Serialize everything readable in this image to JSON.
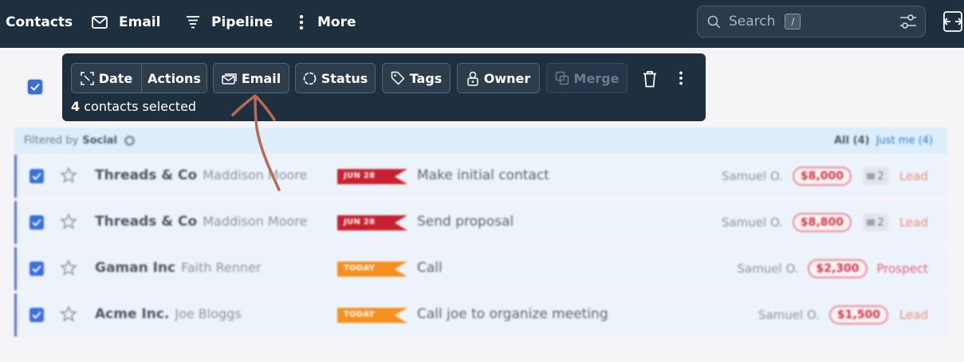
{
  "nav": {
    "contacts": "Contacts",
    "email": "Email",
    "pipeline": "Pipeline",
    "more": "More",
    "search_placeholder": "Search",
    "search_shortcut": "/"
  },
  "toolbar": {
    "date": "Date",
    "actions": "Actions",
    "email": "Email",
    "status": "Status",
    "tags": "Tags",
    "owner": "Owner",
    "merge": "Merge",
    "selected_count": "4",
    "selected_suffix": "contacts selected"
  },
  "filter": {
    "label": "Filtered by",
    "value": "Social",
    "all": "All (4)",
    "just_me": "Just me (4)"
  },
  "rows": [
    {
      "company": "Threads & Co",
      "person": "Maddison Moore",
      "due": "JUN 28",
      "task": "Make initial contact",
      "owner": "Samuel O.",
      "value": "$8,000",
      "files": "2",
      "stage": "Lead"
    },
    {
      "company": "Threads & Co",
      "person": "Maddison Moore",
      "due": "JUN 28",
      "task": "Send proposal",
      "owner": "Samuel O.",
      "value": "$8,800",
      "files": "2",
      "stage": "Lead"
    },
    {
      "company": "Gaman Inc",
      "person": "Faith Renner",
      "due": "TODAY",
      "task": "Call",
      "owner": "Samuel O.",
      "value": "$2,300",
      "files": "",
      "stage": "Prospect"
    },
    {
      "company": "Acme Inc.",
      "person": "Joe Bloggs",
      "due": "TODAY",
      "task": "Call joe to organize meeting",
      "owner": "Samuel O.",
      "value": "$1,500",
      "files": "",
      "stage": "Lead"
    }
  ],
  "colors": {
    "nav_bg": "#1e2f40",
    "overdue_flag": "#c8202e",
    "today_flag": "#f5901f",
    "checkbox": "#3a6fd8",
    "annotation_arrow": "#b86a55"
  }
}
